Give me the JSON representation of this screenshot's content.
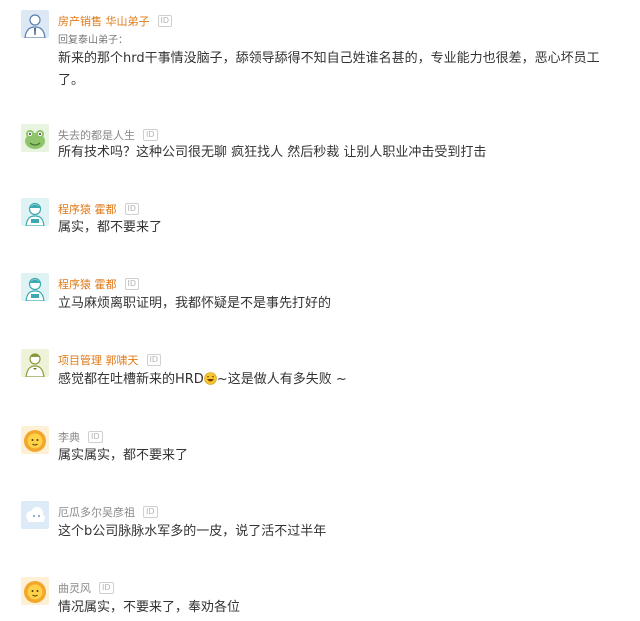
{
  "comments": [
    {
      "username": "房产销售 华山弟子",
      "id_badge": "ID",
      "reply_to": "回复泰山弟子：",
      "text": "新来的那个hrd干事情没脑子，舔领导舔得不知自己姓谁名甚的，专业能力也很差，恶心坏员工了。",
      "avatar_icon": "person-white-shirt-avatar-icon"
    },
    {
      "username": "失去的都是人生",
      "id_badge": "ID",
      "text": "所有技术吗？这种公司很无聊 疯狂找人 然后秒裁 让别人职业冲击受到打击",
      "avatar_icon": "frog-avatar-icon"
    },
    {
      "username": "程序猿 霍都",
      "id_badge": "ID",
      "text": "属实，都不要来了",
      "avatar_icon": "programmer-avatar-icon"
    },
    {
      "username": "程序猿 霍都",
      "id_badge": "ID",
      "text": "立马麻烦离职证明，我都怀疑是不是事先打好的",
      "avatar_icon": "programmer-avatar-icon"
    },
    {
      "username": "项目管理 郭啸天",
      "id_badge": "ID",
      "text_before": "感觉都在吐槽新来的HRD",
      "emoji_icon": "laughing-emoji-icon",
      "text_after": "~这是做人有多失败 ~",
      "avatar_icon": "manager-avatar-icon"
    },
    {
      "username": "李典",
      "id_badge": "ID",
      "text": "属实属实，都不要来了",
      "avatar_icon": "lion-avatar-icon"
    },
    {
      "username": "厄瓜多尔吴彦祖",
      "id_badge": "ID",
      "text": "这个b公司脉脉水军多的一皮，说了活不过半年",
      "avatar_icon": "cloud-avatar-icon"
    },
    {
      "username": "曲灵风",
      "id_badge": "ID",
      "text": "情况属实，不要来了，奉劝各位",
      "avatar_icon": "lion-avatar-icon"
    }
  ],
  "colors": {
    "username_orange": "#e07a18",
    "username_gray": "#888888",
    "text": "#333333"
  }
}
